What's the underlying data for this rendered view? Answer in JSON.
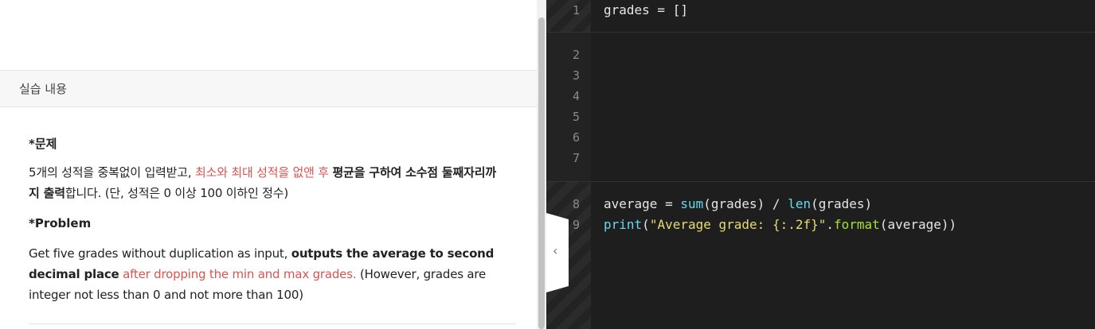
{
  "left_panel": {
    "section_title": "실습 내용",
    "problem_ko_heading": "*문제",
    "problem_ko": {
      "part1": "5개의 성적을 중복없이 입력받고, ",
      "part2_red": "최소와 최대 성적을 없앤 후",
      "part3": " ",
      "part4_bold": "평균을 구하여 소수점 둘째자리까지 출력",
      "part5": "합니다. (단, 성적은 0 이상 100 이하인 정수)"
    },
    "problem_en_heading": "*Problem",
    "problem_en": {
      "part1": "Get five grades without duplication as input, ",
      "part2_bold": "outputs the average to second decimal place",
      "part3": " ",
      "part4_red": "after dropping the min and max grades.",
      "part5": " (However, grades are integer not less than 0 and not more than 100)"
    }
  },
  "editor": {
    "lines": [
      {
        "num": "1",
        "text": "grades = []"
      },
      {
        "num": "2",
        "text": ""
      },
      {
        "num": "3",
        "text": ""
      },
      {
        "num": "4",
        "text": ""
      },
      {
        "num": "5",
        "text": ""
      },
      {
        "num": "6",
        "text": ""
      },
      {
        "num": "7",
        "text": ""
      },
      {
        "num": "8",
        "tokens": [
          "average = ",
          "sum",
          "(grades) / ",
          "len",
          "(grades)"
        ]
      },
      {
        "num": "9",
        "tokens": [
          "print",
          "(",
          "\"Average grade: {:.2f}\"",
          ".",
          "format",
          "(average))"
        ]
      }
    ]
  },
  "collapse_tab": {
    "icon": "chevron-left-icon",
    "glyph": "‹"
  },
  "colors": {
    "accent_red": "#d9534f",
    "editor_bg": "#1e1e1e"
  }
}
